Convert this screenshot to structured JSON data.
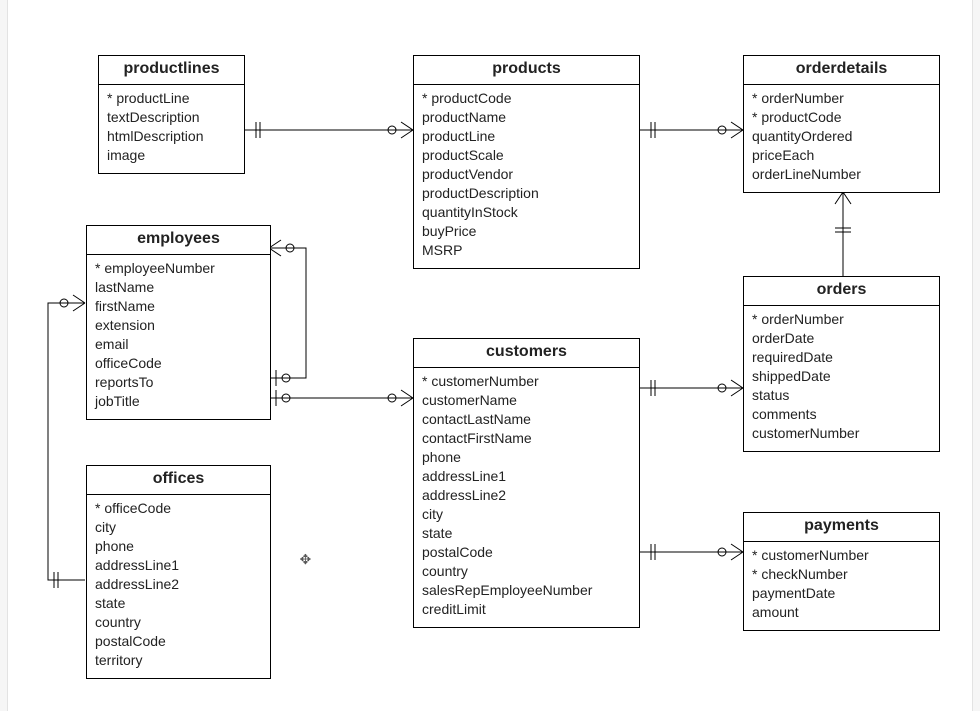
{
  "entities": {
    "productlines": {
      "title": "productlines",
      "cols": [
        "* productLine",
        "  textDescription",
        "  htmlDescription",
        "  image"
      ]
    },
    "products": {
      "title": "products",
      "cols": [
        "* productCode",
        "  productName",
        "  productLine",
        "  productScale",
        "  productVendor",
        "  productDescription",
        "  quantityInStock",
        "  buyPrice",
        "  MSRP"
      ]
    },
    "orderdetails": {
      "title": "orderdetails",
      "cols": [
        "* orderNumber",
        "* productCode",
        "  quantityOrdered",
        "  priceEach",
        "  orderLineNumber"
      ]
    },
    "employees": {
      "title": "employees",
      "cols": [
        "* employeeNumber",
        "  lastName",
        "  firstName",
        "  extension",
        "  email",
        "  officeCode",
        "  reportsTo",
        "  jobTitle"
      ]
    },
    "customers": {
      "title": "customers",
      "cols": [
        "* customerNumber",
        "  customerName",
        "  contactLastName",
        "  contactFirstName",
        "  phone",
        "  addressLine1",
        "  addressLine2",
        "  city",
        "  state",
        "  postalCode",
        "  country",
        "  salesRepEmployeeNumber",
        "  creditLimit"
      ]
    },
    "orders": {
      "title": "orders",
      "cols": [
        "* orderNumber",
        "  orderDate",
        "  requiredDate",
        "  shippedDate",
        "  status",
        "  comments",
        "  customerNumber"
      ]
    },
    "offices": {
      "title": "offices",
      "cols": [
        "* officeCode",
        "  city",
        "  phone",
        "  addressLine1",
        "  addressLine2",
        "  state",
        "  country",
        "  postalCode",
        "  territory"
      ]
    },
    "payments": {
      "title": "payments",
      "cols": [
        "* customerNumber",
        "* checkNumber",
        "  paymentDate",
        "  amount"
      ]
    }
  },
  "relationships": [
    {
      "from": "productlines",
      "to": "products",
      "cardinality": "one-to-many"
    },
    {
      "from": "products",
      "to": "orderdetails",
      "cardinality": "one-to-many"
    },
    {
      "from": "orderdetails",
      "to": "orders",
      "cardinality": "many-to-one"
    },
    {
      "from": "customers",
      "to": "orders",
      "cardinality": "one-to-many"
    },
    {
      "from": "customers",
      "to": "payments",
      "cardinality": "one-to-many"
    },
    {
      "from": "employees",
      "to": "customers",
      "cardinality": "one-to-many"
    },
    {
      "from": "employees",
      "to": "employees",
      "note": "reportsTo self-reference",
      "cardinality": "one-to-many"
    },
    {
      "from": "offices",
      "to": "employees",
      "cardinality": "one-to-many"
    }
  ],
  "cursorGlyph": "✥"
}
